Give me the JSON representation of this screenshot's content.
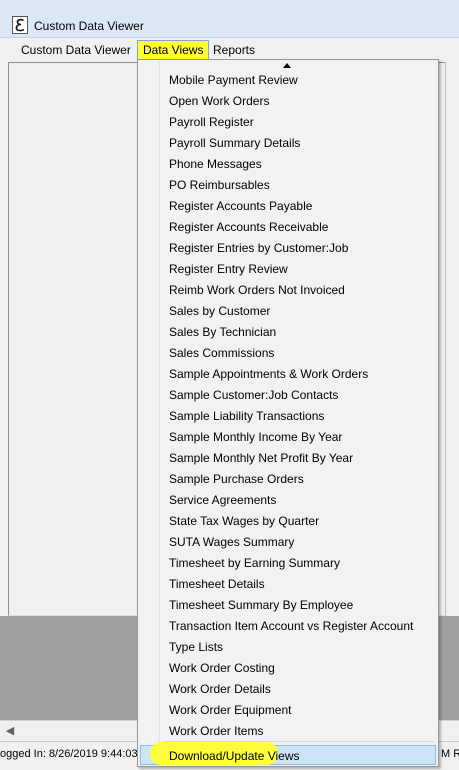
{
  "window": {
    "title": "Custom Data Viewer",
    "icon": "app-e-icon"
  },
  "menubar": {
    "items": [
      {
        "label": "Custom Data Viewer"
      },
      {
        "label": "Data Views",
        "state": "open"
      },
      {
        "label": "Reports"
      }
    ]
  },
  "dropdown": {
    "scroll_icon": "scroll-up-arrow-icon",
    "items": [
      {
        "label": "Mobile Payment Review"
      },
      {
        "label": "Open Work Orders"
      },
      {
        "label": "Payroll Register"
      },
      {
        "label": "Payroll Summary Details"
      },
      {
        "label": "Phone Messages"
      },
      {
        "label": "PO Reimbursables"
      },
      {
        "label": "Register Accounts Payable"
      },
      {
        "label": "Register Accounts Receivable"
      },
      {
        "label": "Register Entries by Customer:Job"
      },
      {
        "label": "Register Entry Review"
      },
      {
        "label": "Reimb Work Orders Not Invoiced"
      },
      {
        "label": "Sales by Customer"
      },
      {
        "label": "Sales By Technician"
      },
      {
        "label": "Sales Commissions"
      },
      {
        "label": "Sample Appointments & Work Orders"
      },
      {
        "label": "Sample Customer:Job Contacts"
      },
      {
        "label": "Sample Liability Transactions"
      },
      {
        "label": "Sample Monthly Income By Year"
      },
      {
        "label": "Sample Monthly Net Profit By Year"
      },
      {
        "label": "Sample Purchase Orders"
      },
      {
        "label": "Service Agreements"
      },
      {
        "label": "State Tax Wages by Quarter"
      },
      {
        "label": "SUTA Wages Summary"
      },
      {
        "label": "Timesheet by Earning Summary"
      },
      {
        "label": "Timesheet Details"
      },
      {
        "label": "Timesheet Summary By Employee"
      },
      {
        "label": "Transaction Item Account vs Register Account"
      },
      {
        "label": "Type Lists"
      },
      {
        "label": "Work Order Costing"
      },
      {
        "label": "Work Order Details"
      },
      {
        "label": "Work Order Equipment"
      },
      {
        "label": "Work Order Items"
      }
    ],
    "bottom_item": {
      "label": "Download/Update Views",
      "state": "hovered"
    }
  },
  "statusbar": {
    "logged_in": "ogged In: 8/26/2019 9:44:03",
    "right_fragment": "M Re"
  },
  "colors": {
    "highlight": "#ffff33",
    "hover": "#cce4f7",
    "titlebar": "#dce7f5"
  }
}
